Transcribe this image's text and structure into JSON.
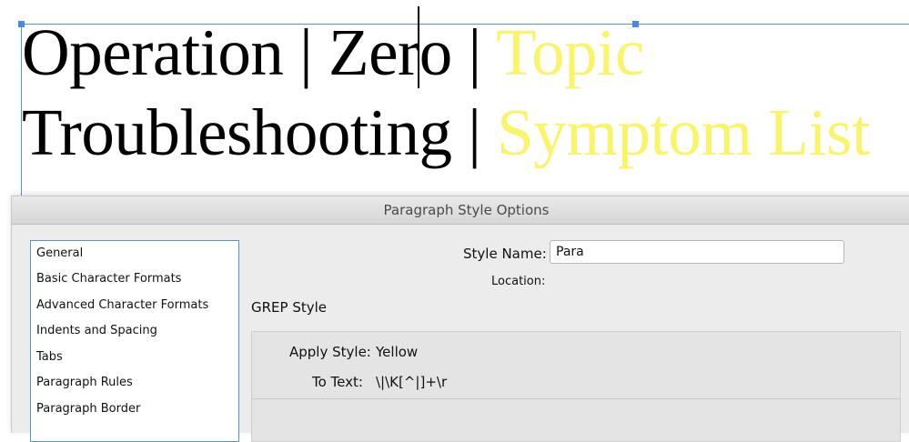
{
  "document": {
    "line1": {
      "black": "Operation | Zero | ",
      "yellow": "Topic"
    },
    "line2": {
      "black": "Troubleshooting | ",
      "yellow": "Symptom List"
    }
  },
  "colors": {
    "highlight": "#faf46a",
    "selection": "#4a8ae6"
  },
  "dialog": {
    "title": "Paragraph Style Options",
    "sidebar": [
      "General",
      "Basic Character Formats",
      "Advanced Character Formats",
      "Indents and Spacing",
      "Tabs",
      "Paragraph Rules",
      "Paragraph Border"
    ],
    "style_name_label": "Style Name:",
    "style_name_value": "Para",
    "location_label": "Location:",
    "section_title": "GREP Style",
    "grep": {
      "apply_style_label": "Apply Style:",
      "apply_style_value": "Yellow",
      "to_text_label": "To Text:",
      "to_text_value": "\\|\\K[^|]+\\r"
    }
  }
}
